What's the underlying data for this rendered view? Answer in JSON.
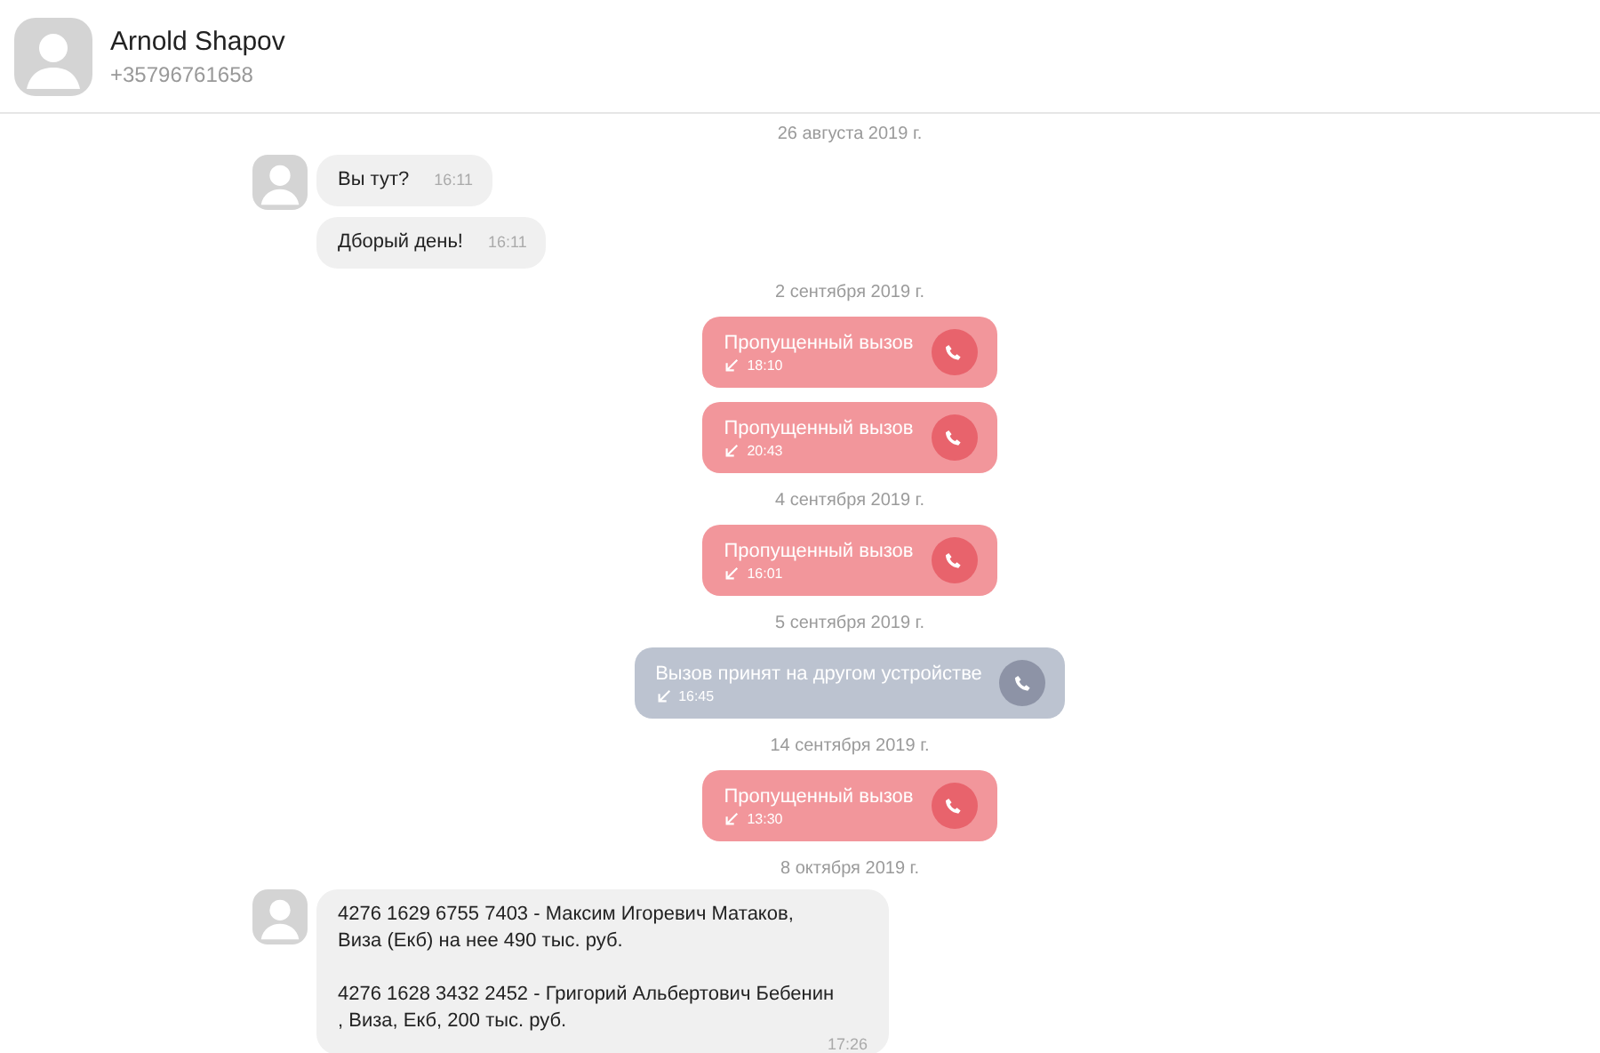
{
  "contact": {
    "name": "Arnold Shapov",
    "phone": "+35796761658"
  },
  "items": [
    {
      "kind": "date",
      "text": "26 августа 2019 г."
    },
    {
      "kind": "message",
      "avatar": true,
      "text": "Вы тут?",
      "time": "16:11"
    },
    {
      "kind": "message",
      "avatar": false,
      "text": "Дборый день!",
      "time": "16:11"
    },
    {
      "kind": "date",
      "text": "2 сентября 2019 г."
    },
    {
      "kind": "call",
      "missed": true,
      "label": "Пропущенный вызов",
      "time": "18:10"
    },
    {
      "kind": "call",
      "missed": true,
      "label": "Пропущенный вызов",
      "time": "20:43"
    },
    {
      "kind": "date",
      "text": "4 сентября 2019 г."
    },
    {
      "kind": "call",
      "missed": true,
      "label": "Пропущенный вызов",
      "time": "16:01"
    },
    {
      "kind": "date",
      "text": "5 сентября 2019 г."
    },
    {
      "kind": "call",
      "missed": false,
      "label": "Вызов принят на другом устройстве",
      "time": "16:45"
    },
    {
      "kind": "date",
      "text": "14 сентября 2019 г."
    },
    {
      "kind": "call",
      "missed": true,
      "label": "Пропущенный вызов",
      "time": "13:30"
    },
    {
      "kind": "date",
      "text": "8 октября 2019 г."
    },
    {
      "kind": "message",
      "avatar": true,
      "text": "4276 1629 6755 7403 - Максим Игоревич Матаков,\nВиза (Екб) на нее 490 тыс. руб.\n\n4276 1628 3432 2452 - Григорий Альбертович Бебенин\n, Виза, Екб, 200 тыс. руб.",
      "time": "17:26"
    }
  ]
}
